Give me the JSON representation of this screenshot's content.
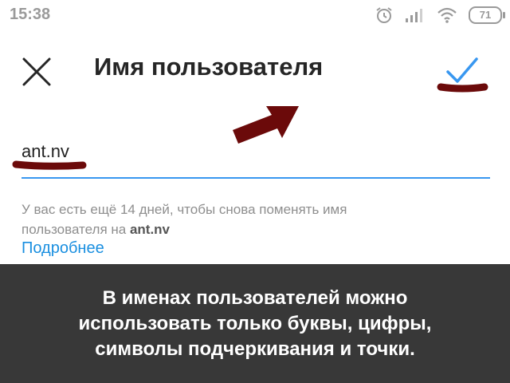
{
  "status_bar": {
    "time": "15:38",
    "battery_level": "71",
    "icons": [
      "alarm-icon",
      "signal-icon",
      "wifi-icon",
      "battery-icon"
    ]
  },
  "header": {
    "title": "Имя пользователя",
    "close_icon": "close-icon",
    "confirm_icon": "checkmark-icon"
  },
  "form": {
    "username_value": "ant.nv",
    "helper_prefix": "У вас есть ещё 14 дней, чтобы снова поменять имя пользователя на ",
    "helper_username": "ant.nv",
    "learn_more": "Подробнее"
  },
  "caption": {
    "text": "В именах пользователей можно использовать только буквы, цифры, символы подчеркивания и точки."
  },
  "colors": {
    "accent": "#3897f0",
    "link": "#1a8fe0",
    "annotation": "#6b0a0a",
    "banner": "#383838"
  }
}
